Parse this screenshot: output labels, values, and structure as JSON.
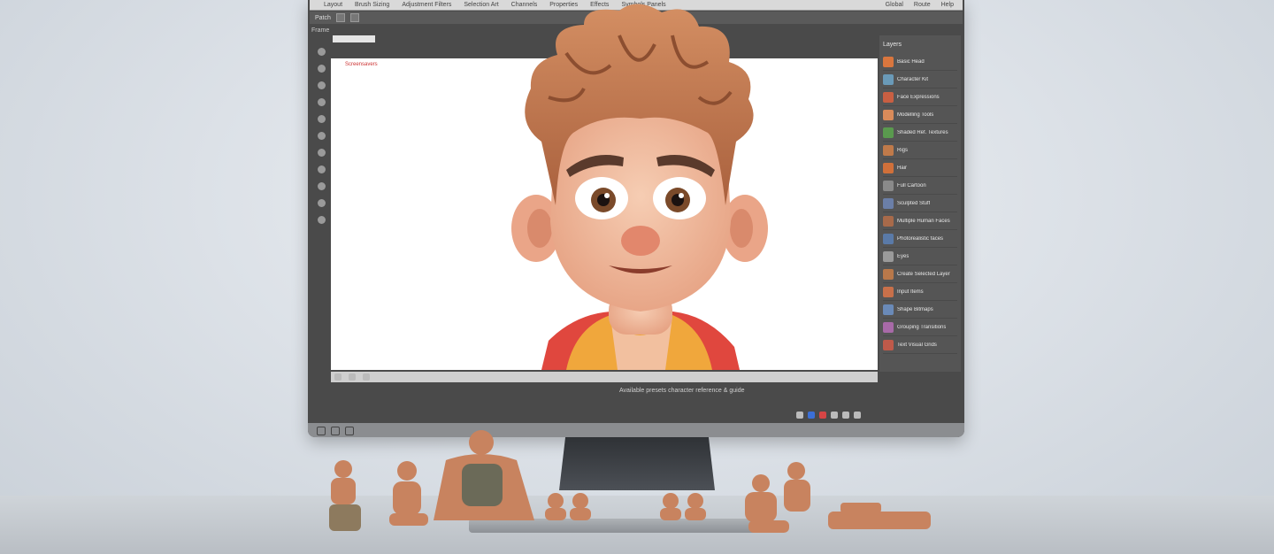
{
  "scene": {
    "description_colors": {
      "background": "#dde2e8",
      "monitor_frame": "#4a4a4a",
      "canvas": "#ffffff",
      "skin": "#f0b89b",
      "hair": "#c8825a",
      "hoodie": "#f0a73c",
      "figurine": "#c8835f"
    }
  },
  "app": {
    "menu": [
      "Layout",
      "Brush Sizing",
      "Adjustment Filters",
      "Selection Art",
      "Channels",
      "Properties",
      "Effects",
      "Symbols Panels"
    ],
    "menu_right": [
      "Global",
      "Route",
      "Help"
    ],
    "toolbar_label": "Patch",
    "doc_tab": "Frame",
    "canvas_caption": "Screensavers",
    "status_text": "Available presets character reference & guide",
    "right_panel": {
      "header": "Layers",
      "rows": [
        {
          "label": "Basic Head",
          "color": "#d9763e"
        },
        {
          "label": "Character Kit",
          "color": "#6a9ab8"
        },
        {
          "label": "Face Expressions",
          "color": "#c95f42"
        },
        {
          "label": "Modelling Tools",
          "color": "#d98b5a"
        },
        {
          "label": "Shaded Ref. Textures",
          "color": "#5a9a4e"
        },
        {
          "label": "Rigs",
          "color": "#c07a4a"
        },
        {
          "label": "Hair",
          "color": "#d0703a"
        },
        {
          "label": "Full Cartoon",
          "color": "#8a8a8a"
        },
        {
          "label": "Sculpted Stuff",
          "color": "#6b7fa8"
        },
        {
          "label": "Multiple Human Faces",
          "color": "#a86a4a"
        },
        {
          "label": "Photorealistic faces",
          "color": "#5a7aa8"
        },
        {
          "label": "Eyes",
          "color": "#9a9a9a"
        },
        {
          "label": "Create Selected Layer",
          "color": "#b8784a"
        },
        {
          "label": "Input Items",
          "color": "#c8704a"
        },
        {
          "label": "Shape Bitmaps",
          "color": "#6a8ab8"
        },
        {
          "label": "Grouping Transitions",
          "color": "#a86aa8"
        },
        {
          "label": "Text Visual Grids",
          "color": "#c05a4a"
        }
      ]
    }
  }
}
